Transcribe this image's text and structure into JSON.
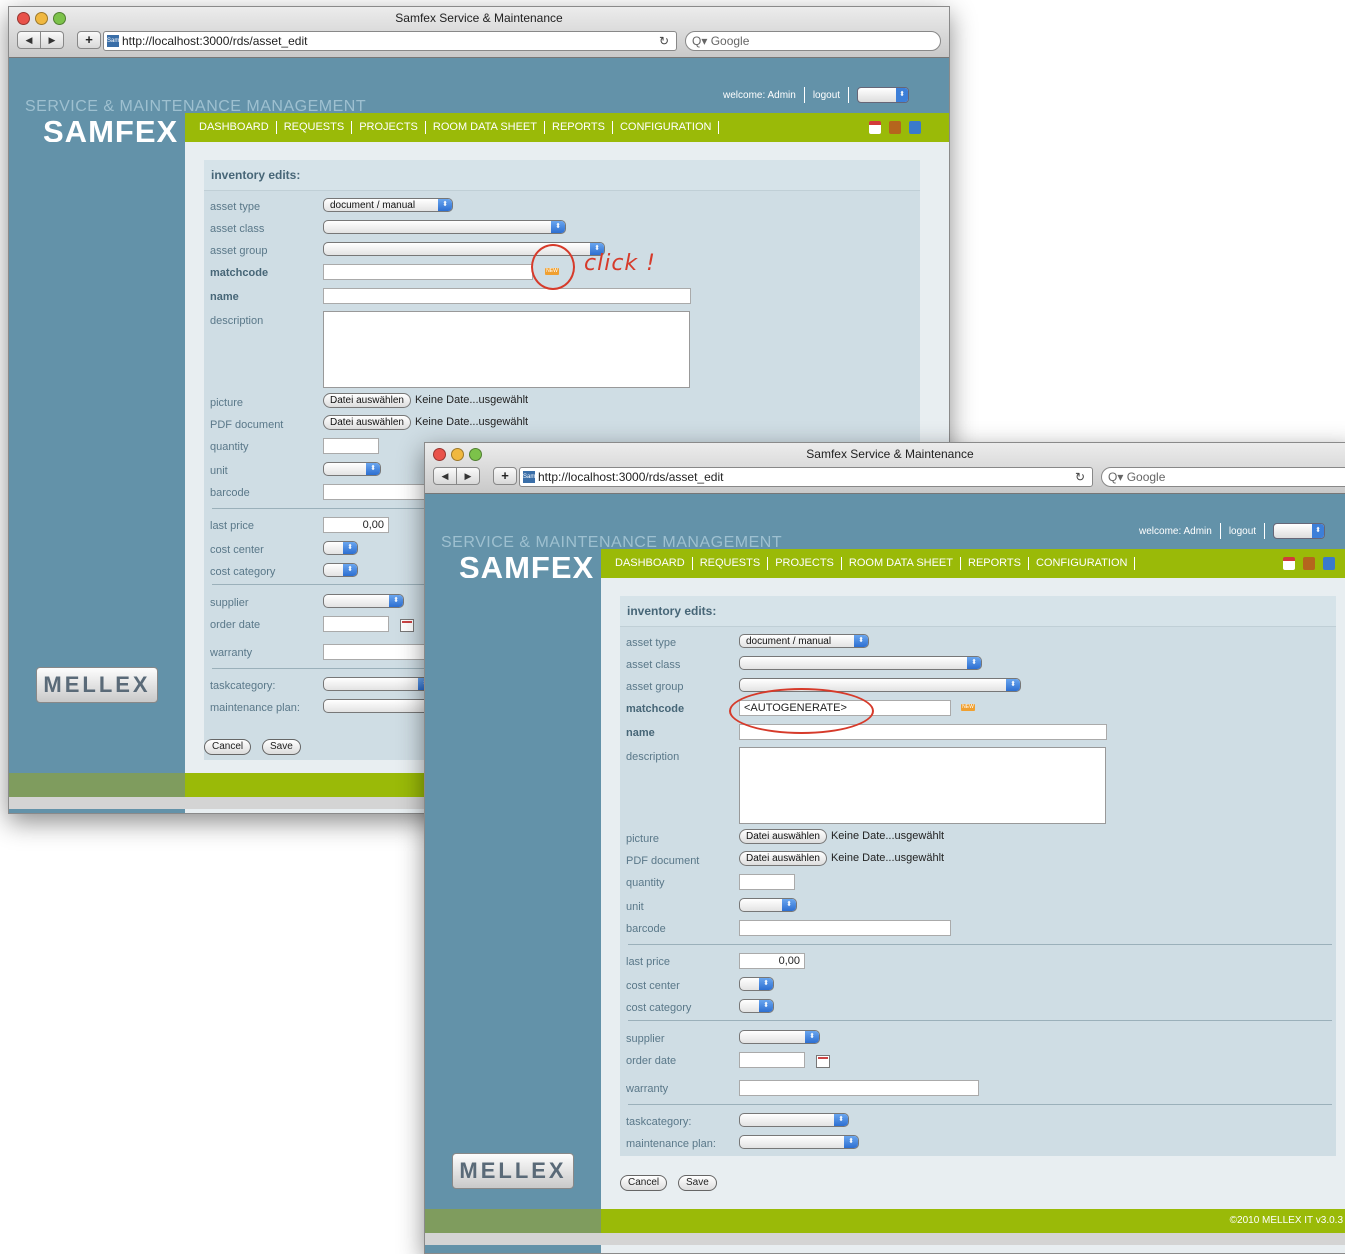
{
  "window": {
    "title": "Samfex Service & Maintenance",
    "url": "http://localhost:3000/rds/asset_edit",
    "search_placeholder": "Q▾ Google",
    "reload_glyph": "↻"
  },
  "header": {
    "tagline": "SERVICE & MAINTENANCE MANAGEMENT",
    "logo_sam": "SAM",
    "logo_fex": "FEX",
    "welcome": "welcome: Admin",
    "logout": "logout",
    "icons": [
      "calendar-icon",
      "book-icon",
      "calculator-icon"
    ]
  },
  "nav": [
    "DASHBOARD",
    "REQUESTS",
    "PROJECTS",
    "ROOM DATA SHEET",
    "REPORTS",
    "CONFIGURATION"
  ],
  "sidebar": {
    "logo": "MELLEX"
  },
  "form": {
    "heading": "inventory edits:",
    "labels": {
      "asset_type": "asset type",
      "asset_class": "asset class",
      "asset_group": "asset group",
      "matchcode": "matchcode",
      "name": "name",
      "description": "description",
      "picture": "picture",
      "pdf": "PDF document",
      "quantity": "quantity",
      "unit": "unit",
      "barcode": "barcode",
      "last_price": "last price",
      "cost_center": "cost center",
      "cost_category": "cost category",
      "supplier": "supplier",
      "order_date": "order date",
      "warranty": "warranty",
      "taskcategory": "taskcategory:",
      "maintenance_plan": "maintenance plan:"
    },
    "asset_type_value": "document / manual",
    "file_button": "Datei auswählen",
    "no_file": "Keine Date...usgewählt",
    "last_price_value": "0,00",
    "matchcode_before": "",
    "matchcode_after": "<AUTOGENERATE>",
    "new_badge": "NEW",
    "cancel": "Cancel",
    "save": "Save"
  },
  "annotation": {
    "text": "click !"
  },
  "footer": {
    "copyright": "©2010 MELLEX IT v3.0.3"
  },
  "colors": {
    "accent_green": "#9aba08",
    "sidebar_blue": "#6392a9",
    "annotation_red": "#d63a2a"
  }
}
